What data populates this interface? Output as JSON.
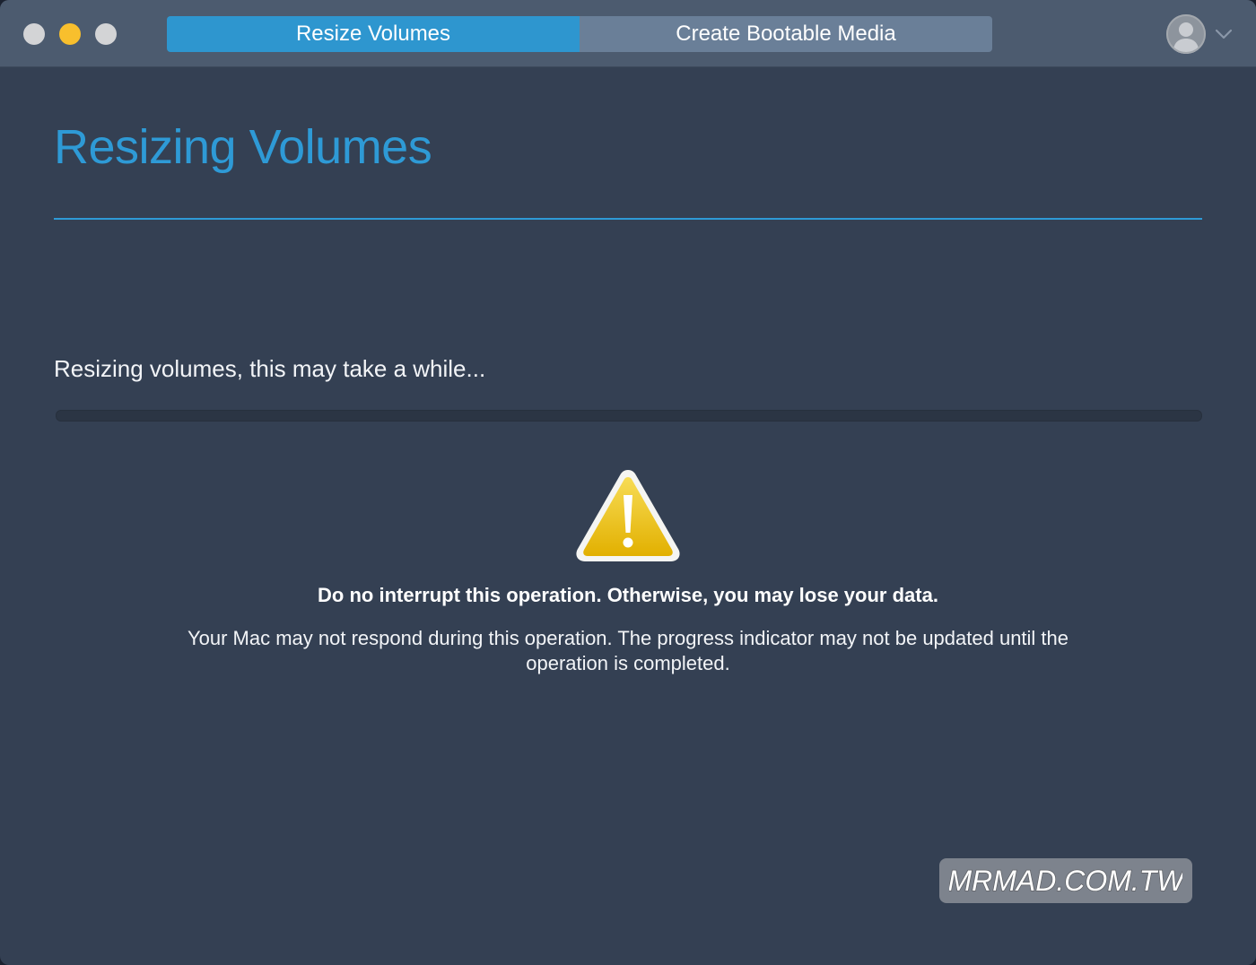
{
  "window": {
    "traffic_lights": [
      "close",
      "minimize",
      "maximize"
    ]
  },
  "toolbar": {
    "tabs": [
      {
        "label": "Resize Volumes",
        "active": true
      },
      {
        "label": "Create Bootable Media",
        "active": false
      }
    ],
    "account_icon": "user-avatar-icon",
    "menu_icon": "chevron-down-icon"
  },
  "main": {
    "title": "Resizing Volumes",
    "status": "Resizing volumes, this may take a while...",
    "progress": 0,
    "warning": {
      "icon": "warning-triangle-icon",
      "headline": "Do no interrupt this operation. Otherwise, you may lose your data.",
      "body": "Your Mac may not respond during this operation. The progress indicator may not be updated until the operation is completed."
    }
  },
  "watermark": {
    "text": "MRMAD.COM.TW"
  },
  "colors": {
    "accent": "#2e9ad6",
    "background": "#344053",
    "titlebar": "#4c5b6f",
    "active_tab": "#2e96cf",
    "inactive_tab": "#6a7f98",
    "warning_yellow": "#f0c419"
  }
}
